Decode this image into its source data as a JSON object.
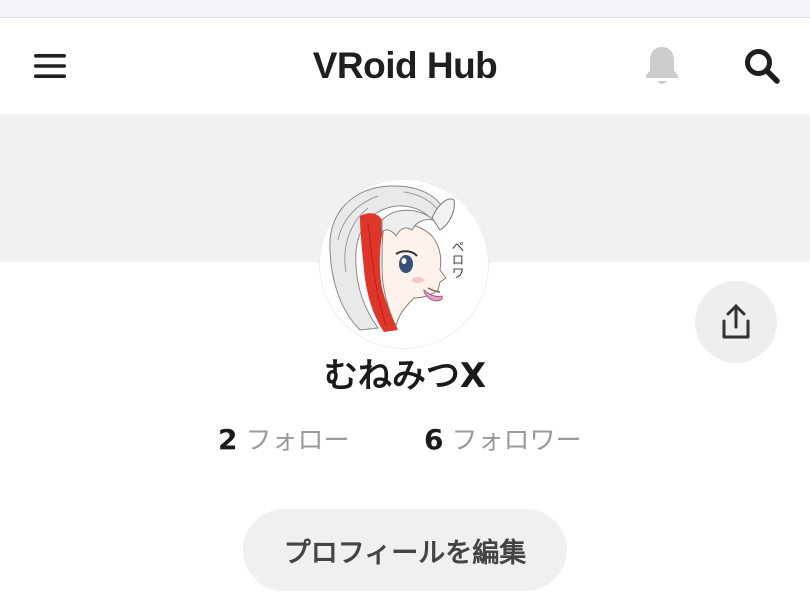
{
  "header": {
    "logo_text": "VRoid Hub",
    "menu_icon": "hamburger-menu-icon",
    "notification_icon": "bell-icon",
    "search_icon": "search-icon"
  },
  "profile": {
    "username": "むねみつX",
    "following_count": "2",
    "following_label": "フォロー",
    "followers_count": "6",
    "followers_label": "フォロワー",
    "edit_profile_label": "プロフィールを編集",
    "share_icon": "share-icon",
    "avatar_caption_text": "ペロワ"
  },
  "colors": {
    "cover_background": "#f1f1f1",
    "button_background": "#eeeeee",
    "muted_text": "#9a9a9a",
    "bell_disabled": "#cccccc",
    "avatar_hair_accent": "#e0352b"
  }
}
